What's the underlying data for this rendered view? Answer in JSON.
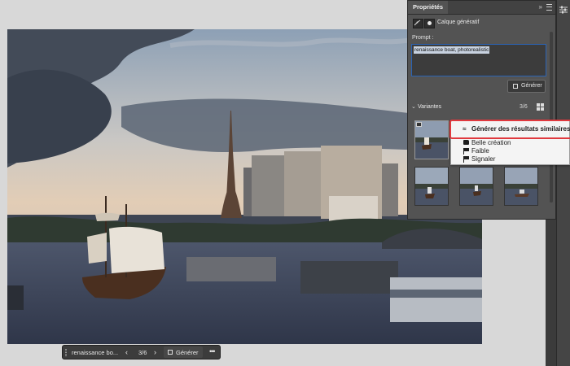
{
  "panel": {
    "tab_label": "Propriétés",
    "collapse_glyph": "»",
    "layer_label": "Calque génératif",
    "prompt_label": "Prompt :",
    "prompt_value": "renaissance boat, photorealistic",
    "generate_label": "Générer",
    "variants_label": "Variantes",
    "variants_count": "3/6",
    "variants_chevron": "⌄"
  },
  "context_menu": {
    "items": [
      {
        "icon": "similar-results-icon",
        "glyph": "≈",
        "label": "Générer des résultats similaires"
      },
      {
        "icon": "thumbs-up-icon",
        "label": "Belle création"
      },
      {
        "icon": "flag-icon",
        "label": "Faible"
      },
      {
        "icon": "flag-icon",
        "label": "Signaler"
      }
    ],
    "highlight_color": "#e0393e"
  },
  "taskbar": {
    "prompt": "renaissance bo...",
    "prev_glyph": "‹",
    "count": "3/6",
    "next_glyph": "›",
    "generate_label": "Générer",
    "more_glyph": "•••"
  },
  "colors": {
    "panel_bg": "#535353",
    "accent_blue": "#2a64b6",
    "highlight_red": "#e0393e"
  }
}
